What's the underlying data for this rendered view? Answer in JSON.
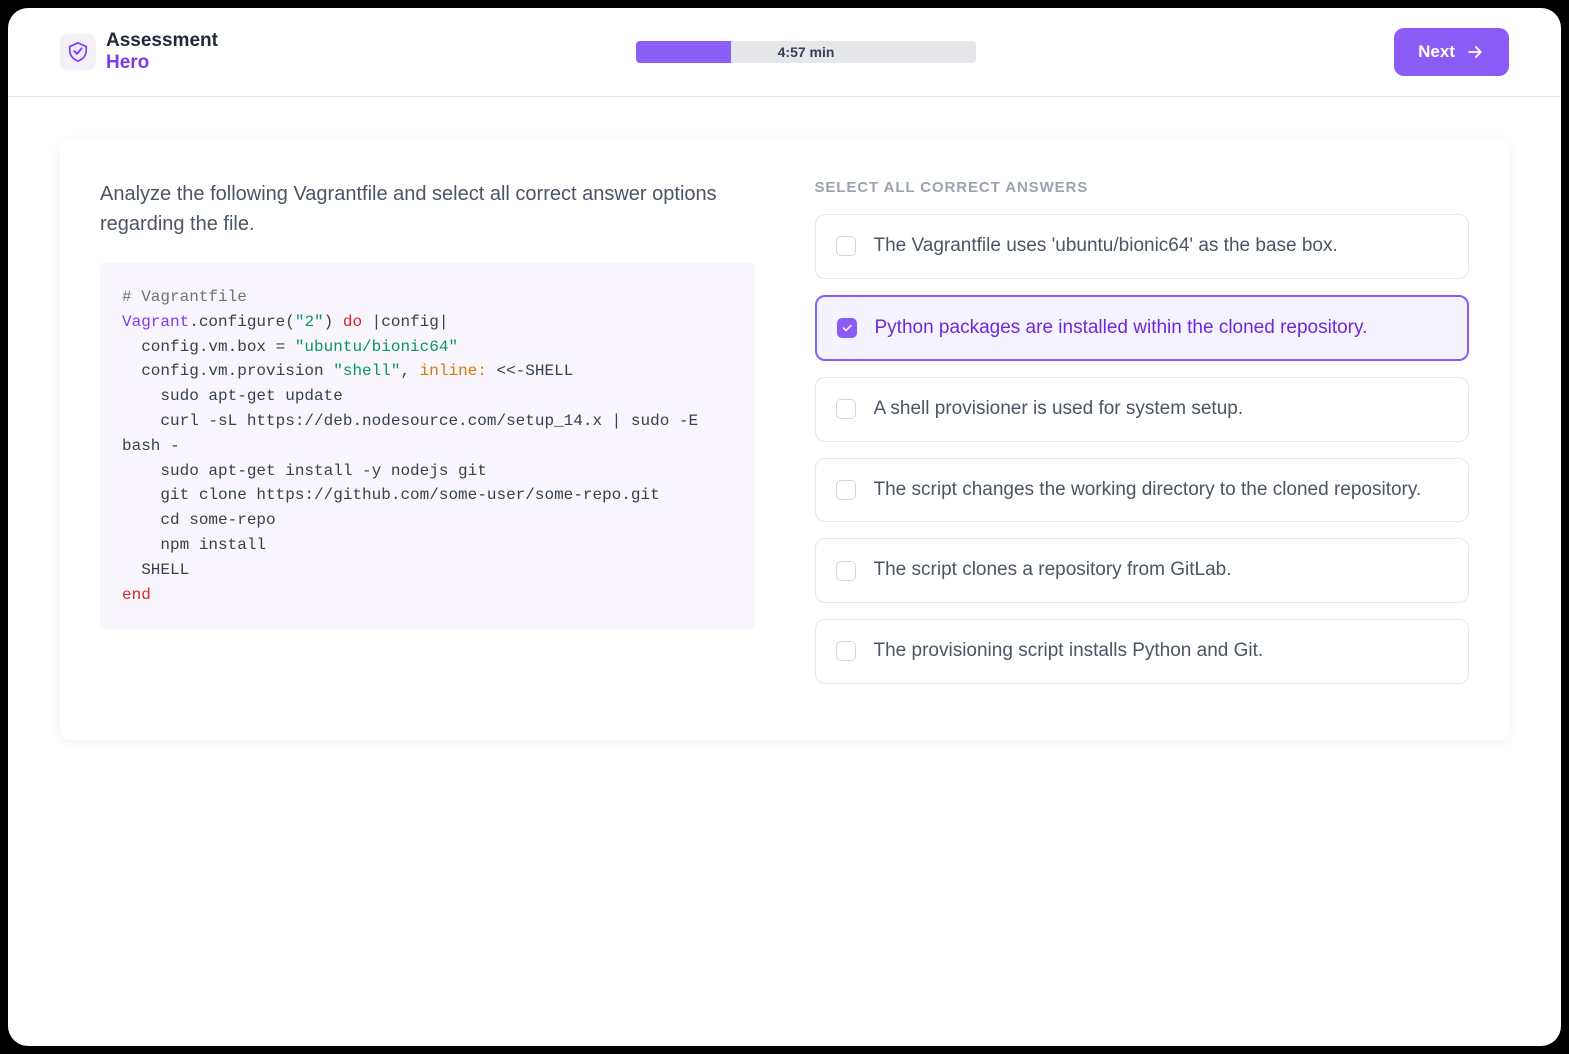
{
  "brand": {
    "line1": "Assessment",
    "line2": "Hero"
  },
  "timer": {
    "label": "4:57 min",
    "progress_percent": 28
  },
  "next_button": {
    "label": "Next"
  },
  "question": {
    "prompt": "Analyze the following Vagrantfile and select all correct answer options regarding the file.",
    "code_tokens": [
      {
        "t": "# Vagrantfile",
        "c": "c-comment"
      },
      {
        "t": "\n"
      },
      {
        "t": "Vagrant",
        "c": "c-const"
      },
      {
        "t": ".configure("
      },
      {
        "t": "\"2\"",
        "c": "c-str"
      },
      {
        "t": ") "
      },
      {
        "t": "do",
        "c": "c-kw"
      },
      {
        "t": " |config|\n"
      },
      {
        "t": "  config.vm.box = "
      },
      {
        "t": "\"ubuntu/bionic64\"",
        "c": "c-str"
      },
      {
        "t": "\n"
      },
      {
        "t": "  config.vm.provision "
      },
      {
        "t": "\"shell\"",
        "c": "c-str"
      },
      {
        "t": ", "
      },
      {
        "t": "inline:",
        "c": "c-sym"
      },
      {
        "t": " <<-SHELL\n"
      },
      {
        "t": "    sudo apt-get update\n"
      },
      {
        "t": "    curl -sL https://deb.nodesource.com/setup_14.x | sudo -E bash -\n"
      },
      {
        "t": "    sudo apt-get install -y nodejs git\n"
      },
      {
        "t": "    git clone https://github.com/some-user/some-repo.git\n"
      },
      {
        "t": "    cd some-repo\n"
      },
      {
        "t": "    npm install\n"
      },
      {
        "t": "  SHELL\n"
      },
      {
        "t": "end",
        "c": "c-kw"
      }
    ]
  },
  "answers": {
    "heading": "SELECT ALL CORRECT ANSWERS",
    "options": [
      {
        "label": "The Vagrantfile uses 'ubuntu/bionic64' as the base box.",
        "selected": false
      },
      {
        "label": "Python packages are installed within the cloned repository.",
        "selected": true
      },
      {
        "label": "A shell provisioner is used for system setup.",
        "selected": false
      },
      {
        "label": "The script changes the working directory to the cloned repository.",
        "selected": false
      },
      {
        "label": "The script clones a repository from GitLab.",
        "selected": false
      },
      {
        "label": "The provisioning script installs Python and Git.",
        "selected": false
      }
    ]
  }
}
